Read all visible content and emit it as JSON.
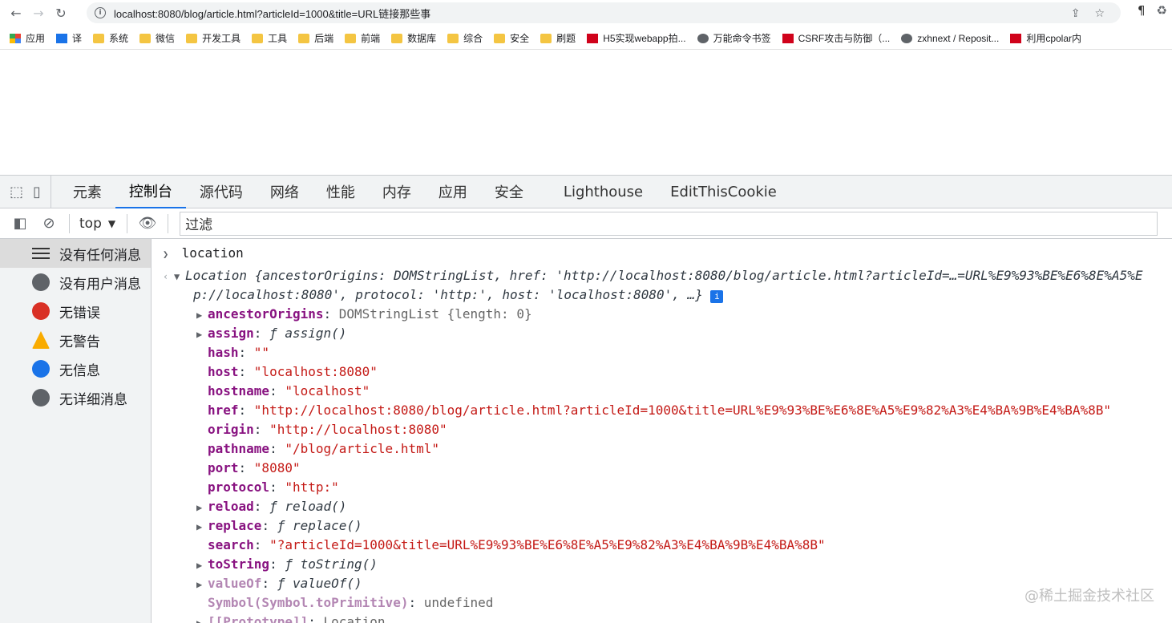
{
  "browser": {
    "url": "localhost:8080/blog/article.html?articleId=1000&title=URL链接那些事",
    "bookmarks": [
      {
        "label": "应用",
        "icon": "apps-grid-icon"
      },
      {
        "label": "译",
        "icon": "translate-icon"
      },
      {
        "label": "系统",
        "icon": "folder-icon"
      },
      {
        "label": "微信",
        "icon": "folder-icon"
      },
      {
        "label": "开发工具",
        "icon": "folder-icon"
      },
      {
        "label": "工具",
        "icon": "folder-icon"
      },
      {
        "label": "后端",
        "icon": "folder-icon"
      },
      {
        "label": "前端",
        "icon": "folder-icon"
      },
      {
        "label": "数据库",
        "icon": "folder-icon"
      },
      {
        "label": "综合",
        "icon": "folder-icon"
      },
      {
        "label": "安全",
        "icon": "folder-icon"
      },
      {
        "label": "刷题",
        "icon": "folder-icon"
      },
      {
        "label": "H5实现webapp拍...",
        "icon": "csdn-icon"
      },
      {
        "label": "万能命令书签",
        "icon": "globe-icon"
      },
      {
        "label": "CSRF攻击与防御（...",
        "icon": "csdn-icon"
      },
      {
        "label": "zxhnext / Reposit...",
        "icon": "github-icon"
      },
      {
        "label": "利用cpolar内",
        "icon": "csdn-icon"
      }
    ]
  },
  "devtools": {
    "tabs": [
      "元素",
      "控制台",
      "源代码",
      "网络",
      "性能",
      "内存",
      "应用",
      "安全",
      "Lighthouse",
      "EditThisCookie"
    ],
    "active_tab": "控制台",
    "context": "top",
    "filter_placeholder": "过滤",
    "sidebar": [
      {
        "label": "没有任何消息",
        "icon": "list-icon"
      },
      {
        "label": "没有用户消息",
        "icon": "user-icon"
      },
      {
        "label": "无错误",
        "icon": "error-icon"
      },
      {
        "label": "无警告",
        "icon": "warning-icon"
      },
      {
        "label": "无信息",
        "icon": "info-icon"
      },
      {
        "label": "无详细消息",
        "icon": "bug-icon"
      }
    ],
    "console": {
      "input": "location",
      "summary1": "Location {ancestorOrigins: DOMStringList, href: 'http://localhost:8080/blog/article.html?articleId=…=URL%E9%93%BE%E6%8E%A5%E",
      "summary2": "p://localhost:8080', protocol: 'http:', host: 'localhost:8080', …}",
      "props": [
        {
          "k": "ancestorOrigins",
          "v": "DOMStringList {length: 0}",
          "type": "obj",
          "expandable": true
        },
        {
          "k": "assign",
          "v": "ƒ assign()",
          "type": "fn",
          "expandable": true
        },
        {
          "k": "hash",
          "v": "\"\"",
          "type": "str"
        },
        {
          "k": "host",
          "v": "\"localhost:8080\"",
          "type": "str"
        },
        {
          "k": "hostname",
          "v": "\"localhost\"",
          "type": "str"
        },
        {
          "k": "href",
          "v": "\"http://localhost:8080/blog/article.html?articleId=1000&title=URL%E9%93%BE%E6%8E%A5%E9%82%A3%E4%BA%9B%E4%BA%8B\"",
          "type": "str"
        },
        {
          "k": "origin",
          "v": "\"http://localhost:8080\"",
          "type": "str"
        },
        {
          "k": "pathname",
          "v": "\"/blog/article.html\"",
          "type": "str"
        },
        {
          "k": "port",
          "v": "\"8080\"",
          "type": "str"
        },
        {
          "k": "protocol",
          "v": "\"http:\"",
          "type": "str"
        },
        {
          "k": "reload",
          "v": "ƒ reload()",
          "type": "fn",
          "expandable": true
        },
        {
          "k": "replace",
          "v": "ƒ replace()",
          "type": "fn",
          "expandable": true
        },
        {
          "k": "search",
          "v": "\"?articleId=1000&title=URL%E9%93%BE%E6%8E%A5%E9%82%A3%E4%BA%9B%E4%BA%8B\"",
          "type": "str"
        },
        {
          "k": "toString",
          "v": "ƒ toString()",
          "type": "fn",
          "expandable": true
        },
        {
          "k": "valueOf",
          "v": "ƒ valueOf()",
          "type": "fn",
          "expandable": true,
          "dim": true
        },
        {
          "k": "Symbol(Symbol.toPrimitive)",
          "v": "undefined",
          "type": "undef",
          "dim": true
        },
        {
          "k": "[[Prototype]]",
          "v": "Location",
          "type": "obj",
          "expandable": true,
          "dim": true
        }
      ]
    }
  },
  "watermark": "@稀土掘金技术社区"
}
